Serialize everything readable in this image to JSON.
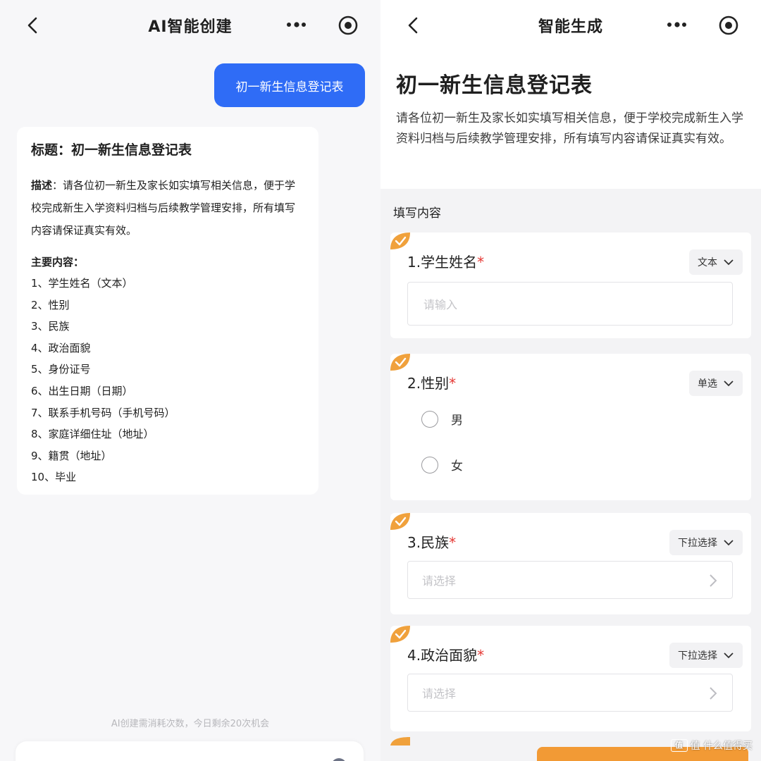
{
  "left_screen": {
    "nav": {
      "title": "AI智能创建",
      "back_icon": "chevron-left-icon",
      "more_icon": "ellipsis-icon",
      "target_icon": "target-icon"
    },
    "user_message": "初一新生信息登记表",
    "ai_reply": {
      "title_line": "标题：初一新生信息登记表",
      "desc_prefix": "描述",
      "desc_text": "：请各位初一新生及家长如实填写相关信息，便于学校完成新生入学资料归档与后续教学管理安排，所有填写内容请保证真实有效。",
      "main_heading": "主要内容：",
      "items": [
        "1、学生姓名（文本）",
        "2、性别",
        "3、民族",
        "4、政治面貌",
        "5、身份证号",
        "6、出生日期（日期）",
        "7、联系手机号码（手机号码）",
        "8、家庭详细住址（地址）",
        "9、籍贯（地址）",
        "10、毕业"
      ]
    },
    "quota_note": "AI创建需消耗次数，今日剩余20次机会"
  },
  "right_screen": {
    "nav": {
      "title": "智能生成",
      "back_icon": "chevron-left-icon",
      "more_icon": "ellipsis-icon",
      "target_icon": "target-icon"
    },
    "form_title": "初一新生信息登记表",
    "form_desc": "请各位初一新生及家长如实填写相关信息，便于学校完成新生入学资料归档与后续教学管理安排，所有填写内容请保证真实有效。",
    "section_label": "填写内容",
    "questions": [
      {
        "label": "1.学生姓名",
        "required_mark": "*",
        "type": "文本",
        "placeholder": "请输入"
      },
      {
        "label": "2.性别",
        "required_mark": "*",
        "type": "单选",
        "options": [
          "男",
          "女"
        ]
      },
      {
        "label": "3.民族",
        "required_mark": "*",
        "type": "下拉选择",
        "placeholder": "请选择"
      },
      {
        "label": "4.政治面貌",
        "required_mark": "*",
        "type": "下拉选择",
        "placeholder": "请选择"
      }
    ],
    "watermark": "值 什么值得买"
  },
  "colors": {
    "primary_blue": "#2f6cf6",
    "accent_orange": "#f29a35",
    "required_red": "#e53935"
  }
}
